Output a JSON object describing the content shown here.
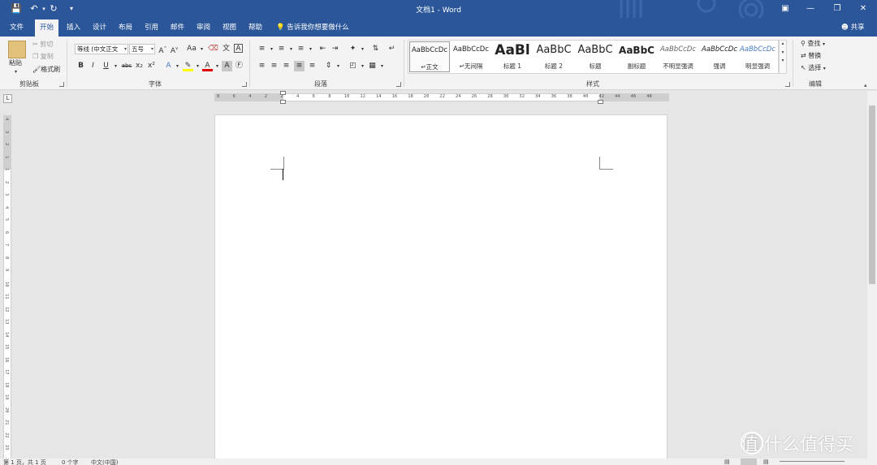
{
  "titlebar": {
    "doc_title": "文档1 - Word",
    "save_icon": "save-icon",
    "undo_icon": "undo-icon",
    "redo_icon": "redo-icon",
    "customize_icon": "customize-qat-icon",
    "accent": "#2b579a"
  },
  "tabs": [
    {
      "label": "文件"
    },
    {
      "label": "开始"
    },
    {
      "label": "插入"
    },
    {
      "label": "设计"
    },
    {
      "label": "布局"
    },
    {
      "label": "引用"
    },
    {
      "label": "邮件"
    },
    {
      "label": "审阅"
    },
    {
      "label": "视图"
    },
    {
      "label": "帮助"
    }
  ],
  "tellme": "告诉我你想要做什么",
  "share": "共享",
  "clipboard": {
    "paste": "粘贴",
    "cut": "剪切",
    "copy": "复制",
    "format_painter": "格式刷",
    "group_label": "剪贴板"
  },
  "font": {
    "font_name": "等线 (中文正文",
    "font_size": "五号",
    "change_case": "Aa",
    "bold": "B",
    "italic": "I",
    "underline": "U",
    "strikethrough": "abc",
    "subscript": "x₂",
    "superscript": "x²",
    "font_color": "A",
    "group_label": "字体"
  },
  "paragraph": {
    "group_label": "段落"
  },
  "styles": {
    "group_label": "样式",
    "items": [
      {
        "preview": "AaBbCcDc",
        "name": "正文"
      },
      {
        "preview": "AaBbCcDc",
        "name": "无间隔"
      },
      {
        "preview": "AaBl",
        "name": "标题 1"
      },
      {
        "preview": "AaBbC",
        "name": "标题 2"
      },
      {
        "preview": "AaBbC",
        "name": "标题"
      },
      {
        "preview": "AaBbC",
        "name": "副标题"
      },
      {
        "preview": "AaBbCcDc",
        "name": "不明显强调"
      },
      {
        "preview": "AaBbCcDc",
        "name": "强调"
      },
      {
        "preview": "AaBbCcDc",
        "name": "明显强调"
      }
    ]
  },
  "editing": {
    "find": "查找",
    "replace": "替换",
    "select": "选择",
    "group_label": "编辑"
  },
  "ruler": {
    "h_ticks": [
      "8",
      "6",
      "4",
      "2",
      "2",
      "4",
      "6",
      "8",
      "10",
      "12",
      "14",
      "16",
      "18",
      "20",
      "22",
      "24",
      "26",
      "28",
      "30",
      "32",
      "34",
      "36",
      "38",
      "40",
      "42",
      "44",
      "46",
      "48"
    ],
    "v_ticks": [
      "4",
      "3",
      "2",
      "1",
      "1",
      "2",
      "3",
      "4",
      "5",
      "6",
      "7",
      "8",
      "9",
      "10",
      "11",
      "12",
      "13",
      "14",
      "15",
      "16",
      "17",
      "18",
      "19",
      "20",
      "21",
      "22",
      "23",
      "24"
    ]
  },
  "status": {
    "page": "第 1 页，共 1 页",
    "words": "0 个字",
    "language": "中文(中国)"
  },
  "watermark": "值 什么值得买"
}
